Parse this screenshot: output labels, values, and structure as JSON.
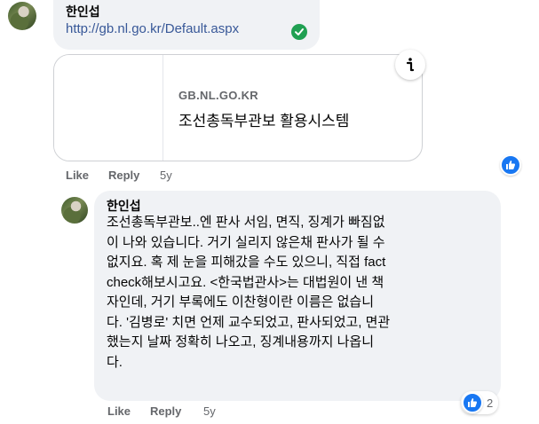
{
  "comment1": {
    "author": "한인섭",
    "link_text": "http://gb.nl.go.kr/Default.aspx",
    "preview": {
      "domain": "GB.NL.GO.KR",
      "title": "조선총독부관보 활용시스템"
    },
    "actions": {
      "like": "Like",
      "reply": "Reply",
      "time": "5y"
    }
  },
  "comment2": {
    "author": "한인섭",
    "body": "조선총독부관보..엔 판사 서임, 면직, 징계가 빠짐없\n이 나와 있습니다. 거기 실리지 않은채 판사가 될 수\n없지요. 혹 제 눈을 피해갔을 수도 있으니, 직접 fact\ncheck해보시고요. <한국법관사>는 대법원이 낸 책\n자인데, 거기 부록에도 이찬형이란 이름은 없습니\n다. '김병로' 치면 언제 교수되었고, 판사되었고, 면관\n했는지 날짜 정확히 나오고, 징계내용까지 나옵니\n다.",
    "actions": {
      "like": "Like",
      "reply": "Reply",
      "time": "5y"
    },
    "reaction_count": "2"
  },
  "colors": {
    "link": "#385898",
    "like_blue": "#1877f2",
    "verified_green": "#20a052",
    "bubble": "#f0f2f5"
  }
}
